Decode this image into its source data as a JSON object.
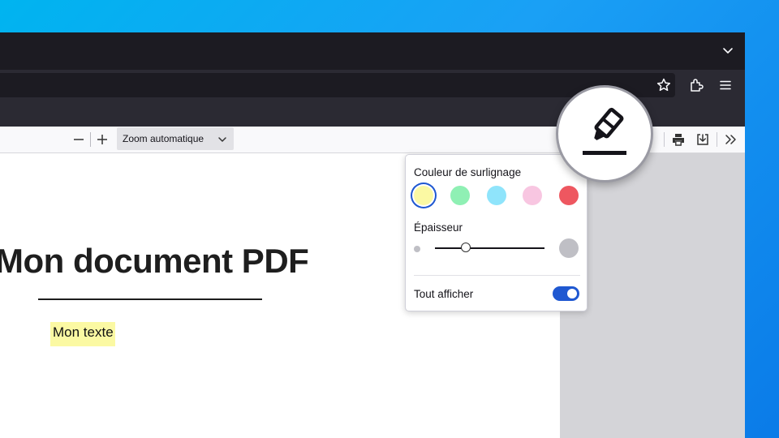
{
  "toolbar": {
    "zoom_select": {
      "value": "Zoom automatique"
    },
    "icons": [
      "zoom-out-icon",
      "zoom-in-icon",
      "chevron-down-icon",
      "print-icon",
      "download-icon",
      "more-tools-icon"
    ]
  },
  "browser": {
    "icons": [
      "tab-list-chevron-icon",
      "bookmark-star-icon",
      "extensions-icon",
      "app-menu-icon"
    ]
  },
  "document": {
    "title": "Mon document PDF",
    "text": "Mon texte",
    "highlight_color": "#fbf9a3"
  },
  "highlight_popup": {
    "color_label": "Couleur de surlignage",
    "colors": [
      {
        "name": "yellow",
        "hex": "#fbf9a3",
        "selected": true
      },
      {
        "name": "green",
        "hex": "#8ff0b4",
        "selected": false
      },
      {
        "name": "blue",
        "hex": "#8fe4fb",
        "selected": false
      },
      {
        "name": "pink",
        "hex": "#f8c6e1",
        "selected": false
      },
      {
        "name": "red",
        "hex": "#ee5760",
        "selected": false
      }
    ],
    "thickness_label": "Épaisseur",
    "thickness_value": 0.28,
    "show_all_label": "Tout afficher",
    "show_all_enabled": true
  },
  "accent_color": "#1f58d1",
  "magnified_icon": "highlighter-icon"
}
